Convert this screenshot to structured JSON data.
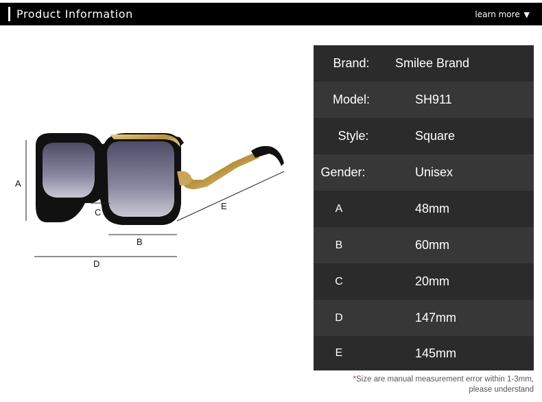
{
  "header": {
    "title": "Product Information",
    "learn_more": "learn more",
    "arrow": "▼"
  },
  "illustration": {
    "labels": {
      "A": "A",
      "B": "B",
      "C": "C",
      "D": "D",
      "E": "E"
    },
    "frame_color": "#111111",
    "lens_color": "#6b6980",
    "temple_color": "#caa45a"
  },
  "spec_table": {
    "rows": [
      {
        "key": "Brand:",
        "value": "Smilee Brand"
      },
      {
        "key": "Model:",
        "value": "SH911"
      },
      {
        "key": "Style:",
        "value": "Square"
      },
      {
        "key": "Gender:",
        "value": "Unisex"
      },
      {
        "key": "A",
        "value": "48mm"
      },
      {
        "key": "B",
        "value": "60mm"
      },
      {
        "key": "C",
        "value": "20mm"
      },
      {
        "key": "D",
        "value": "147mm"
      },
      {
        "key": "E",
        "value": "145mm"
      }
    ]
  },
  "note": {
    "star": "*",
    "line1": "Size are manual measurement error within 1-3mm,",
    "line2": "please understand"
  }
}
